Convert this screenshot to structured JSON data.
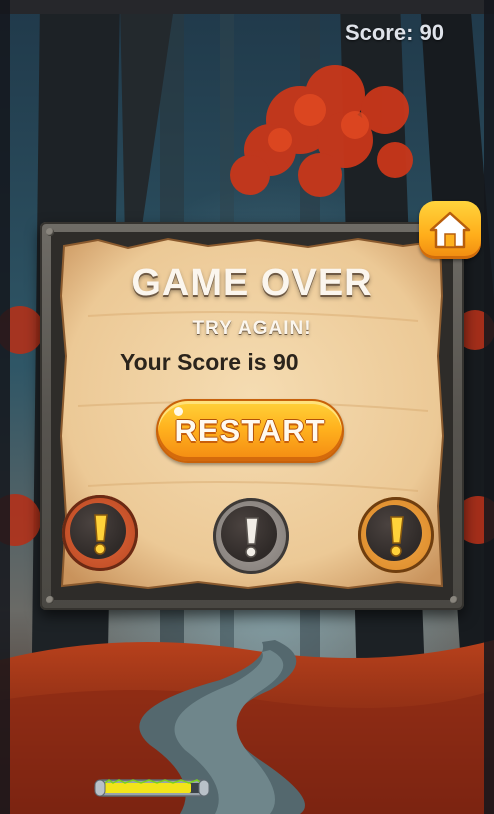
{
  "hud": {
    "score_text": "Score: 90"
  },
  "popup": {
    "title": "GAME OVER",
    "subtitle": "TRY AGAIN!",
    "score_line": "Your Score is 90",
    "restart_label": "RESTART"
  },
  "icons": {
    "home": "home-icon",
    "medals": [
      "exclamation-icon",
      "exclamation-icon",
      "exclamation-icon"
    ]
  },
  "colors": {
    "button_orange": "#ffb21e",
    "parchment": "#f0d2a6",
    "medal_bronze": "#c8552a",
    "medal_silver": "#8c8784",
    "medal_gold": "#e7962f"
  },
  "progress": {
    "fill_fraction": 0.9
  }
}
